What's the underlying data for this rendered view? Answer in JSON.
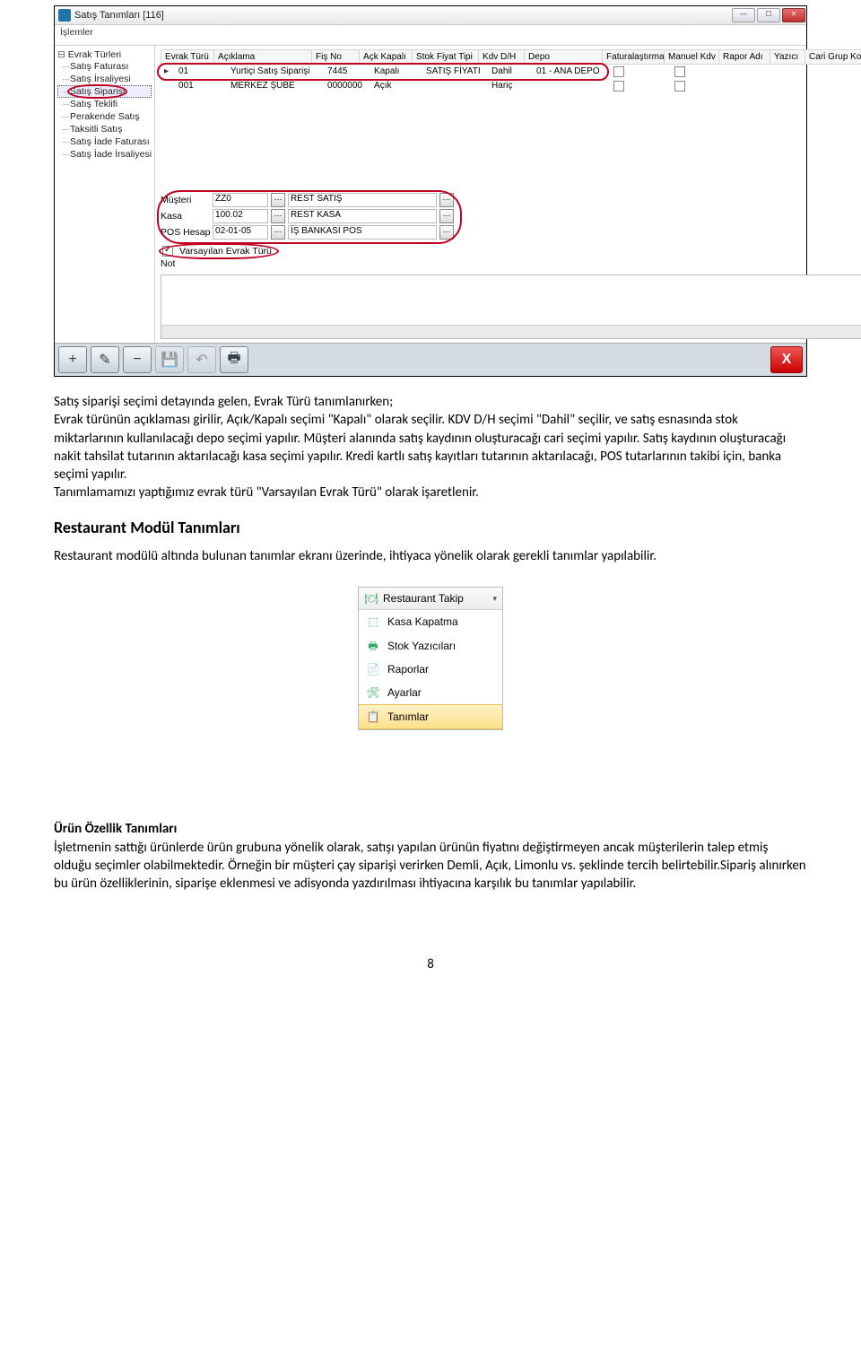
{
  "appWindow": {
    "title": "Satış Tanımları  [116]",
    "menu": {
      "islemler": "İşlemler"
    },
    "tree": {
      "root": "Evrak Türleri",
      "items": [
        "Satış Faturası",
        "Satış İrsaliyesi",
        "Satış Siparişi",
        "Satış Teklifi",
        "Perakende Satış",
        "Taksitli Satış",
        "Satış İade Faturası",
        "Satış İade İrsaliyesi"
      ],
      "selectedIndex": 2
    },
    "grid": {
      "headers": {
        "et": "Evrak Türü",
        "ac": "Açıklama",
        "fn": "Fiş No",
        "ak": "Açk Kapalı",
        "sf": "Stok Fiyat Tipi",
        "kd": "Kdv D/H",
        "dp": "Depo",
        "fa": "Faturalaştırma",
        "mk": "Manuel Kdv",
        "ra": "Rapor Adı",
        "yz": "Yazıcı",
        "cg": "Cari Grup Kodu"
      },
      "rows": [
        {
          "et": "01",
          "ac": "Yurtiçi Satış Siparişi",
          "fn": "7445",
          "ak": "Kapalı",
          "sf": "SATIŞ FİYATI",
          "kd": "Dahil",
          "dp": "01 - ANA DEPO"
        },
        {
          "et": "001",
          "ac": "MERKEZ ŞUBE",
          "fn": "0000000",
          "ak": "Açık",
          "sf": "",
          "kd": "Hariç",
          "dp": ""
        }
      ]
    },
    "details": {
      "musteriLabel": "Müşteri",
      "musteriCode": "ZZ0",
      "musteriName": "REST SATIŞ",
      "kasaLabel": "Kasa",
      "kasaCode": "100.02",
      "kasaName": "REST KASA",
      "posLabel": "POS Hesap",
      "posCode": "02-01-05",
      "posName": "İŞ BANKASI POS",
      "defaultChkLabel": "Varsayılan Evrak Türü",
      "notLabel": "Not"
    },
    "toolbarIcons": {
      "add": "+",
      "edit": "✎",
      "remove": "−",
      "save": "💾",
      "undo": "↶",
      "print": "🖶",
      "close": "X"
    }
  },
  "doc": {
    "p1a": "Satış siparişi seçimi detayında gelen, Evrak Türü tanımlanırken;",
    "p1b": "Evrak türünün açıklaması girilir, Açık/Kapalı seçimi \"Kapalı\" olarak seçilir. KDV D/H seçimi \"Dahil\" seçilir, ve satış esnasında stok miktarlarının kullanılacağı depo seçimi yapılır. Müşteri alanında satış kaydının oluşturacağı cari seçimi yapılır. Satış kaydının oluşturacağı nakit tahsilat tutarının aktarılacağı kasa seçimi yapılır. Kredi kartlı satış kayıtları tutarının aktarılacağı, POS tutarlarının takibi için, banka seçimi yapılır.",
    "p1c": "Tanımlamamızı yaptığımız evrak türü \"Varsayılan Evrak Türü\" olarak işaretlenir.",
    "h2": "Restaurant Modül Tanımları",
    "p2": "Restaurant modülü altında bulunan tanımlar ekranı üzerinde, ihtiyaca yönelik olarak gerekli tanımlar yapılabilir.",
    "menu": {
      "header": "Restaurant Takip",
      "items": [
        "Kasa Kapatma",
        "Stok Yazıcıları",
        "Raporlar",
        "Ayarlar",
        "Tanımlar"
      ]
    },
    "h3": "Ürün Özellik Tanımları",
    "p3": "İşletmenin sattığı ürünlerde ürün grubuna yönelik olarak, satışı yapılan ürünün fiyatını değiştirmeyen ancak müşterilerin talep etmiş olduğu seçimler olabilmektedir. Örneğin bir müşteri çay siparişi verirken Demli, Açık, Limonlu vs. şeklinde tercih belirtebilir.Sipariş alınırken bu ürün özelliklerinin, siparişe eklenmesi ve adisyonda yazdırılması ihtiyacına karşılık bu tanımlar yapılabilir.",
    "pageNum": "8"
  }
}
